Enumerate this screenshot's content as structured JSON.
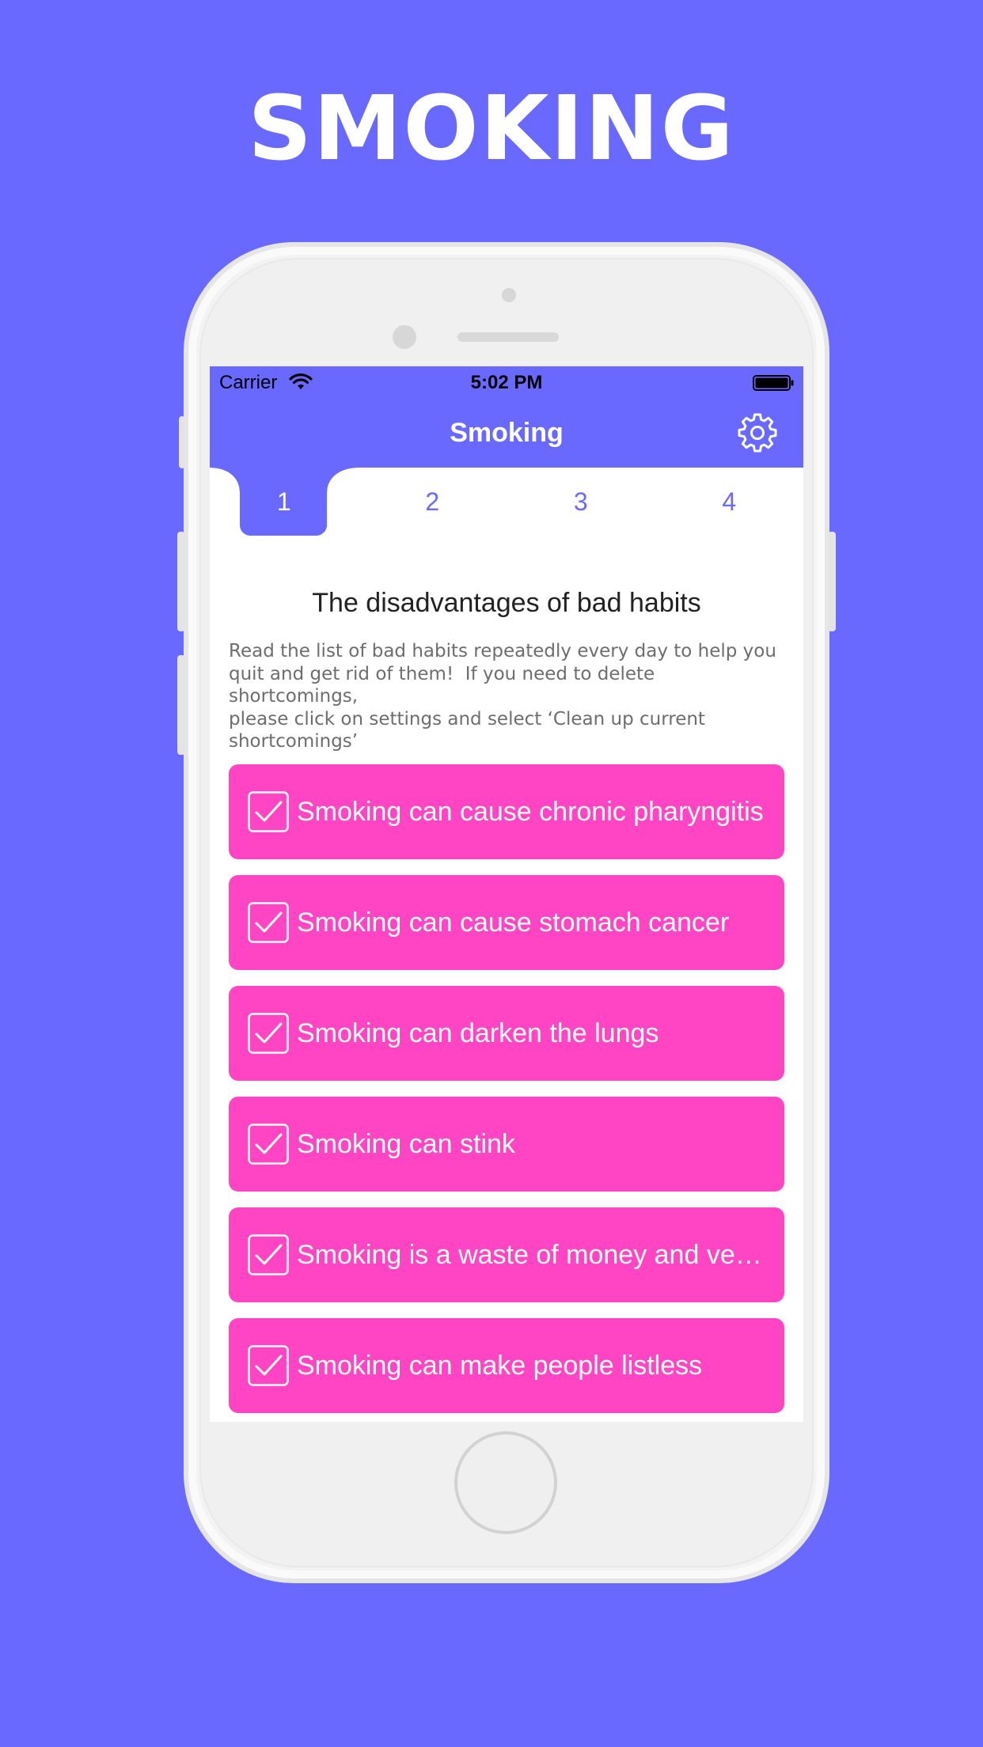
{
  "hero": {
    "title": "SMOKING"
  },
  "status_bar": {
    "carrier": "Carrier",
    "time": "5:02 PM"
  },
  "nav": {
    "title": "Smoking",
    "settings_icon": "gear-icon"
  },
  "tabs": [
    {
      "label": "1",
      "active": true
    },
    {
      "label": "2",
      "active": false
    },
    {
      "label": "3",
      "active": false
    },
    {
      "label": "4",
      "active": false
    }
  ],
  "content": {
    "title": "The disadvantages of bad habits",
    "description": "Read the list of bad habits repeatedly every day to help you\nquit and get rid of them!  If you need to delete shortcomings,\nplease click on settings and select ‘Clean up current\nshortcomings’"
  },
  "habits": [
    {
      "text": "Smoking can cause chronic pharyngitis",
      "checked": true
    },
    {
      "text": "Smoking can cause stomach cancer",
      "checked": true
    },
    {
      "text": "Smoking can darken the lungs",
      "checked": true
    },
    {
      "text": "Smoking can stink",
      "checked": true
    },
    {
      "text": "Smoking is a waste of money and ve…",
      "checked": true
    },
    {
      "text": "Smoking can make people listless",
      "checked": true
    }
  ],
  "colors": {
    "background": "#6969ff",
    "accent": "#6969ff",
    "card": "#ff45c4",
    "white": "#ffffff"
  }
}
